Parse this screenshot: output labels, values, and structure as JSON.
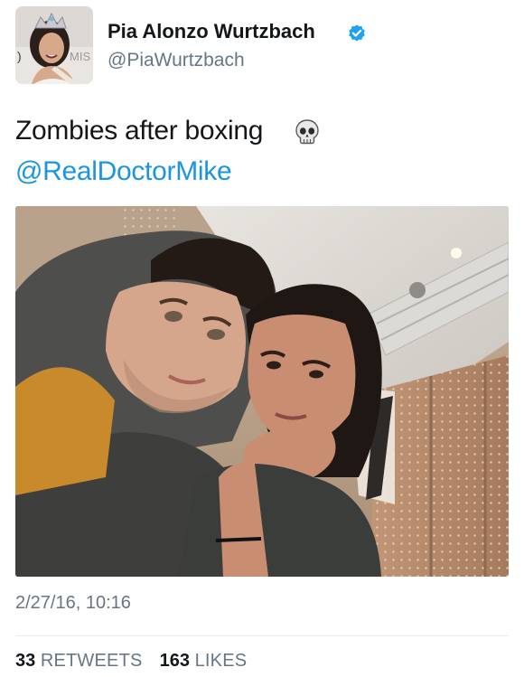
{
  "tweet": {
    "author": {
      "display_name": "Pia Alonzo Wurtzbach",
      "handle": "@PiaWurtzbach",
      "verified": true,
      "avatar_icon": "profile-photo"
    },
    "text": "Zombies after boxing",
    "emoji_icon": "skull-emoji",
    "mention": "@RealDoctorMike",
    "media": {
      "type": "photo",
      "description_icon": "selfie-photo"
    },
    "timestamp": "2/27/16, 10:16",
    "stats": {
      "retweets_count": "33",
      "retweets_label": "RETWEETS",
      "likes_count": "163",
      "likes_label": "LIKES"
    }
  },
  "colors": {
    "link": "#1b95e0",
    "secondary_text": "#657786",
    "primary_text": "#14171a",
    "verified_badge": "#1da1f2",
    "divider": "#e6ecf0"
  }
}
